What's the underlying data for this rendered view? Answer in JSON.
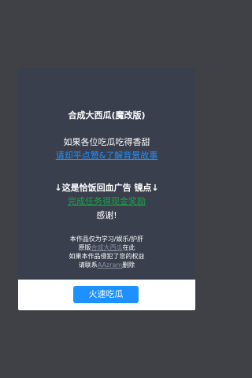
{
  "modal": {
    "title": "合成大西瓜(魔改版)",
    "line_prompt": "如果各位吃瓜吃得香甜",
    "link_story": "请却平点赞&了解背景故事",
    "ad_line": "↓这是恰饭回血广告 镜点↓",
    "link_ad": "完成任务得现金奖励",
    "thanks": "感谢!",
    "notice": {
      "line1": "本作品仅为学习/娱乐/护肝",
      "line2_prefix": "原版",
      "line2_link": "合成大西瓜",
      "line2_suffix": "在此",
      "line3": "如果本作品侵犯了您的权益",
      "line4_prefix": "请联系",
      "line4_link": "AAzram",
      "line4_suffix": "删除"
    }
  },
  "footer": {
    "button_label": "火速吃瓜"
  },
  "colors": {
    "background": "#3f4147",
    "modal_body": "#3a3f4d",
    "link_blue": "#1e90ff",
    "link_green": "#1aa34a",
    "button": "#1e90ff"
  }
}
